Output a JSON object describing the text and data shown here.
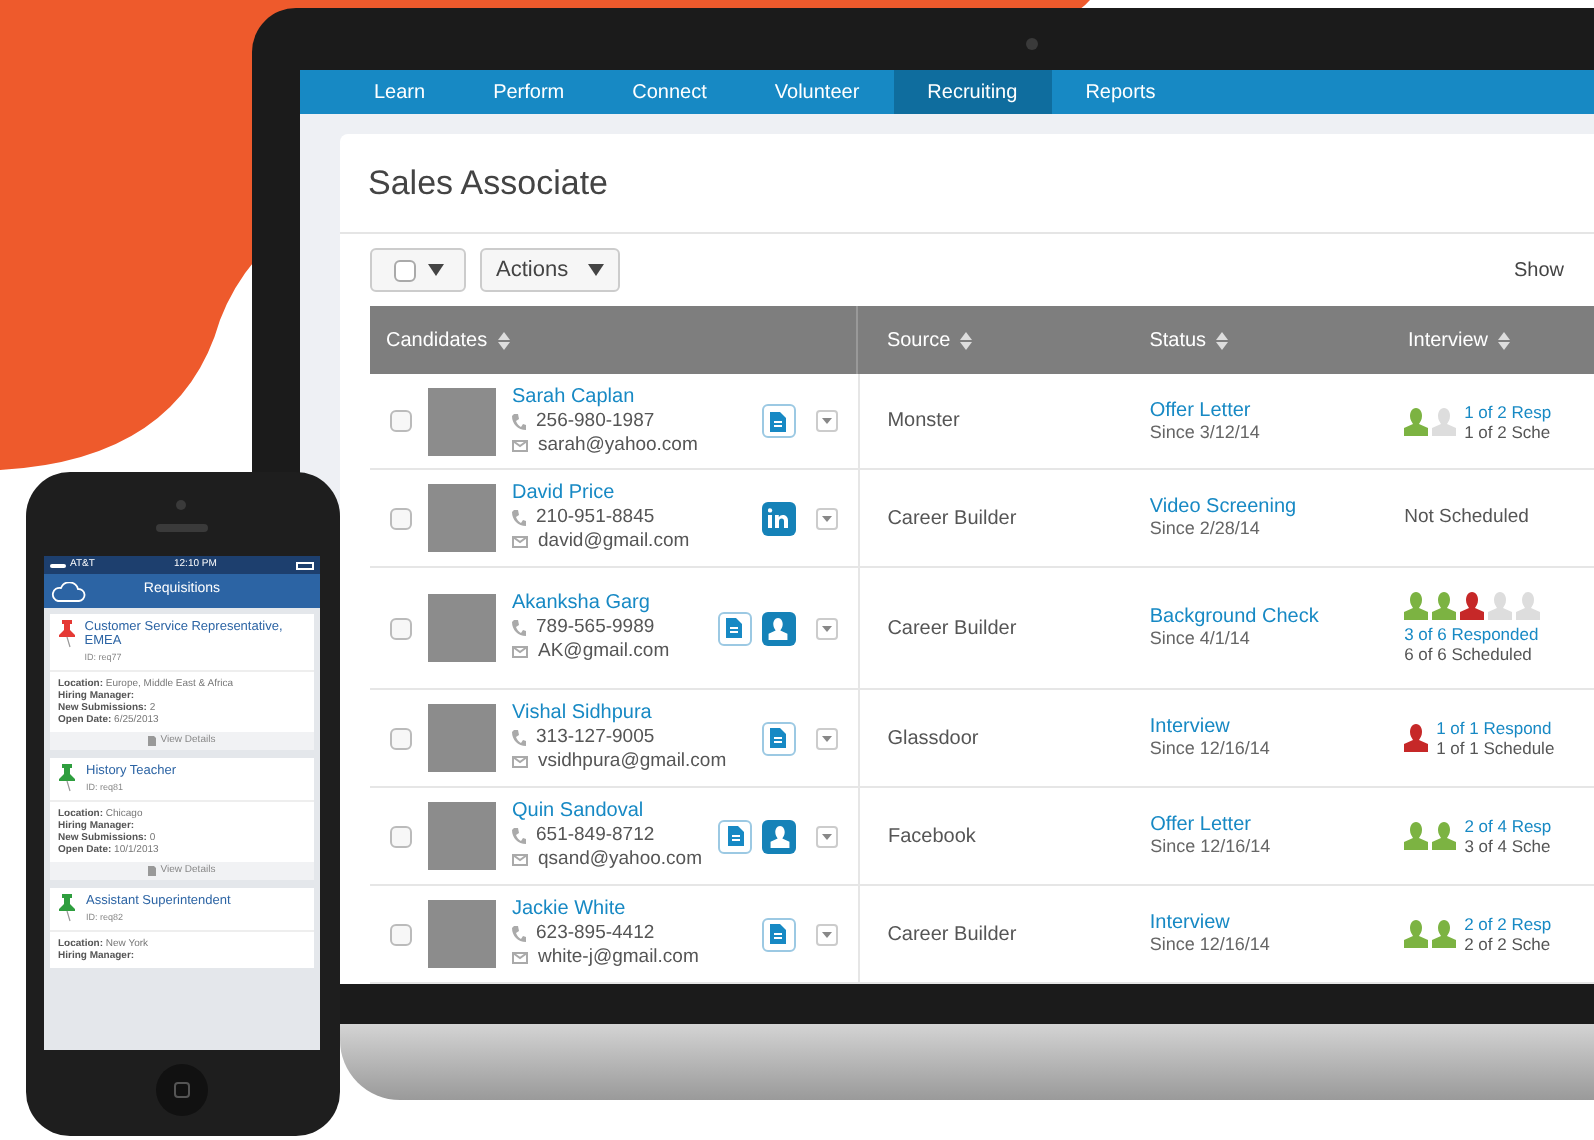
{
  "laptop": {
    "nav_tabs": [
      {
        "label": "Learn",
        "selected": false
      },
      {
        "label": "Perform",
        "selected": false
      },
      {
        "label": "Connect",
        "selected": false
      },
      {
        "label": "Volunteer",
        "selected": false
      },
      {
        "label": "Recruiting",
        "selected": true
      },
      {
        "label": "Reports",
        "selected": false
      }
    ],
    "page_title": "Sales Associate",
    "toolbar": {
      "select_all_checked": false,
      "actions_label": "Actions",
      "show_label": "Show"
    },
    "table": {
      "columns": [
        "Candidates",
        "Source",
        "Status",
        "Interview"
      ],
      "rows": [
        {
          "name": "Sarah Caplan",
          "phone": "256-980-1987",
          "email": "sarah@yahoo.com",
          "checked": false,
          "attachments": [
            {
              "kind": "resume"
            }
          ],
          "source": "Monster",
          "status": "Offer Letter",
          "since": "Since 3/12/14",
          "interviewers": [
            {
              "color": "#7cb342"
            },
            {
              "color": "#dddddd"
            }
          ],
          "responded": "1 of 2 Resp",
          "scheduled": "1 of 2 Sche"
        },
        {
          "name": "David Price",
          "phone": "210-951-8845",
          "email": "david@gmail.com",
          "checked": false,
          "attachments": [
            {
              "kind": "linkedin"
            }
          ],
          "source": "Career Builder",
          "status": "Video Screening",
          "since": "Since 2/28/14",
          "interviewers": [],
          "not_scheduled": "Not Scheduled"
        },
        {
          "name": "Akanksha Garg",
          "phone": "789-565-9989",
          "email": "AK@gmail.com",
          "checked": false,
          "attachments": [
            {
              "kind": "resume"
            },
            {
              "kind": "profile"
            }
          ],
          "source": "Career Builder",
          "status": "Background Check",
          "since": "Since 4/1/14",
          "interviewers": [
            {
              "color": "#7cb342"
            },
            {
              "color": "#7cb342"
            },
            {
              "color": "#c62828"
            },
            {
              "color": "#dddddd"
            },
            {
              "color": "#dddddd"
            }
          ],
          "responded": "3 of 6 Responded",
          "scheduled": "6 of 6 Scheduled"
        },
        {
          "name": "Vishal Sidhpura",
          "phone": "313-127-9005",
          "email": "vsidhpura@gmail.com",
          "checked": false,
          "attachments": [
            {
              "kind": "resume"
            }
          ],
          "source": "Glassdoor",
          "status": "Interview",
          "since": "Since 12/16/14",
          "interviewers": [
            {
              "color": "#c62828"
            }
          ],
          "responded": "1 of 1 Respond",
          "scheduled": "1 of 1 Schedule"
        },
        {
          "name": "Quin Sandoval",
          "phone": "651-849-8712",
          "email": "qsand@yahoo.com",
          "checked": false,
          "attachments": [
            {
              "kind": "resume"
            },
            {
              "kind": "profile"
            }
          ],
          "source": "Facebook",
          "status": "Offer Letter",
          "since": "Since 12/16/14",
          "interviewers": [
            {
              "color": "#7cb342"
            },
            {
              "color": "#7cb342"
            }
          ],
          "responded": "2 of 4 Resp",
          "scheduled": "3 of 4 Sche"
        },
        {
          "name": "Jackie White",
          "phone": "623-895-4412",
          "email": "white-j@gmail.com",
          "checked": false,
          "attachments": [
            {
              "kind": "resume"
            }
          ],
          "source": "Career Builder",
          "status": "Interview",
          "since": "Since 12/16/14",
          "interviewers": [
            {
              "color": "#7cb342"
            },
            {
              "color": "#7cb342"
            }
          ],
          "responded": "2 of 2 Resp",
          "scheduled": "2 of 2 Sche"
        }
      ]
    }
  },
  "phone": {
    "status_bar": {
      "carrier": "AT&T",
      "time": "12:10 PM"
    },
    "title": "Requisitions",
    "cards": [
      {
        "title": "Customer Service Representative, EMEA",
        "id": "ID: req77",
        "color": "#e53935",
        "details": [
          {
            "label": "Location:",
            "value": "Europe, Middle East & Africa"
          },
          {
            "label": "Hiring Manager:"
          },
          {
            "label": "New Submissions:",
            "value": "2"
          },
          {
            "label": "Open Date:",
            "value": "6/25/2013"
          }
        ],
        "link": "View Details"
      },
      {
        "title": "History Teacher",
        "id": "ID: req81",
        "color": "#2e9e3e",
        "details": [
          {
            "label": "Location:",
            "value": "Chicago"
          },
          {
            "label": "Hiring Manager:"
          },
          {
            "label": "New Submissions:",
            "value": "0"
          },
          {
            "label": "Open Date:",
            "value": "10/1/2013"
          }
        ],
        "link": "View Details"
      },
      {
        "title": "Assistant Superintendent",
        "id": "ID: req82",
        "color": "#2e9e3e",
        "details": [
          {
            "label": "Location:",
            "value": "New York"
          },
          {
            "label": "Hiring Manager:"
          }
        ]
      }
    ]
  }
}
